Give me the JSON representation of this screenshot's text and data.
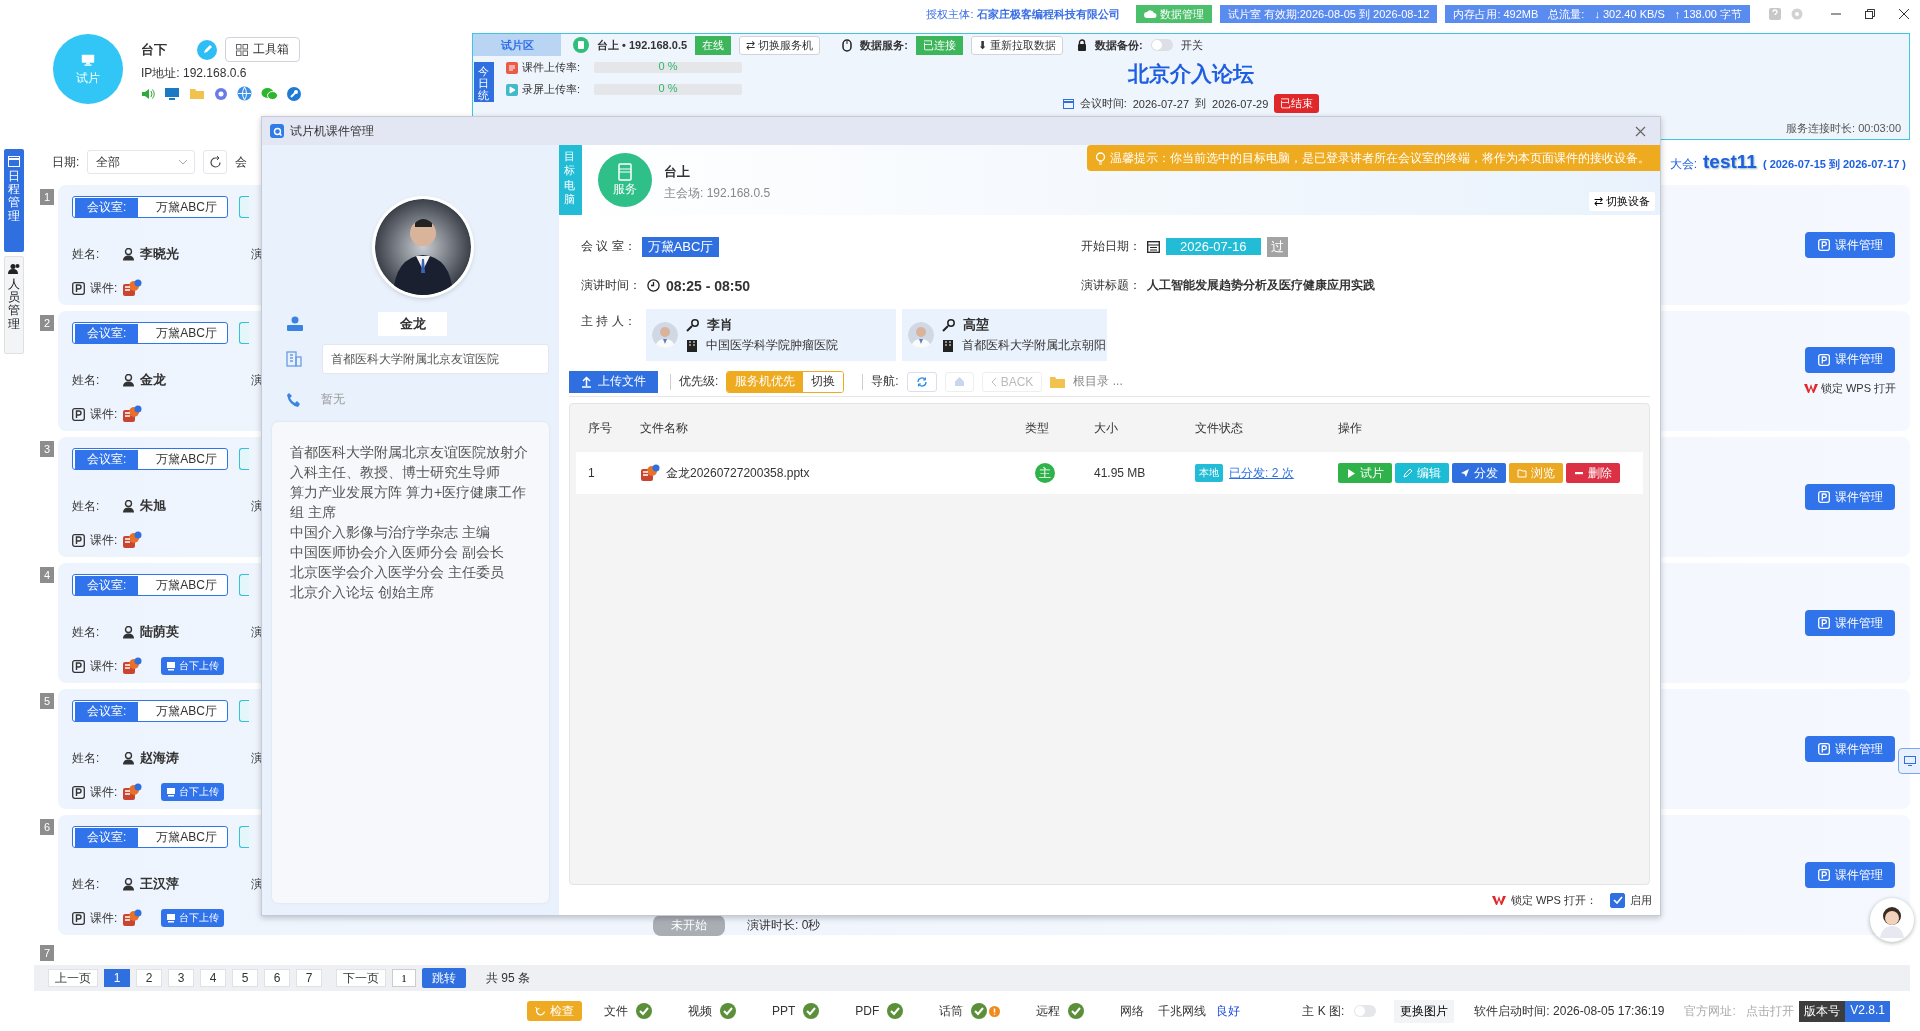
{
  "top_bar": {
    "license_label": "授权主体:",
    "license_holder": "石家庄极客编程科技有限公司",
    "data_button": "数据管理",
    "validity": "试片室 有效期:2026-08-05 到 2026-08-12",
    "memory_label": "内存占用:",
    "memory": "492MB",
    "traffic_label": "总流量:",
    "download": "↓ 302.40 KB/S",
    "upload": "↑ 138.00 字节"
  },
  "station": {
    "avatar_label": "试片",
    "name": "台下",
    "toolbox": "工具箱",
    "ip": "IP地址: 192.168.0.6"
  },
  "trial_panel": {
    "tab": "试片区",
    "host": "台上 • 192.168.0.5",
    "online": "在线",
    "switch_server": "⇄ 切换服务机",
    "data_service_label": "数据服务:",
    "data_service_status": "已连接",
    "refetch": "⬇ 重新拉取数据",
    "backup_label": "数据备份:",
    "backup_on": false,
    "backup_toggle_label": "开关",
    "side_tab": "今日统",
    "rates": [
      {
        "label": "课件上传率:",
        "level": 0,
        "reading": "0 %"
      },
      {
        "label": "录屏上传率:",
        "level": 0,
        "reading": "0 %"
      }
    ],
    "title": "北京介入论坛",
    "meeting_time_label": "会议时间:",
    "start": "2026-07-27",
    "to": "到",
    "end": "2026-07-29",
    "status": "已结束",
    "uptime": "服务连接时长: 00:03:00"
  },
  "sidebar": {
    "items": [
      {
        "label": "日程管理",
        "selected": true
      },
      {
        "label": "人员管理",
        "selected": false
      }
    ]
  },
  "filter": {
    "date_label": "日期:",
    "date_value": "全部",
    "cut_label": "会"
  },
  "congress": {
    "label": "大会:",
    "name": "test11",
    "range": "( 2026-07-15 到 2026-07-17 )"
  },
  "sessions": [
    {
      "index": "1",
      "room_label": "会议室:",
      "room": "万黛ABC厅",
      "name_label": "姓名:",
      "name": "李晓光",
      "cut": "演",
      "course_label": "课件:",
      "manage": "课件管理"
    },
    {
      "index": "2",
      "room_label": "会议室:",
      "room": "万黛ABC厅",
      "name_label": "姓名:",
      "name": "金龙",
      "cut": "演",
      "course_label": "课件:",
      "manage": "课件管理",
      "wps": "锁定 WPS 打开"
    },
    {
      "index": "3",
      "room_label": "会议室:",
      "room": "万黛ABC厅",
      "name_label": "姓名:",
      "name": "朱旭",
      "cut": "演",
      "course_label": "课件:",
      "manage": "课件管理"
    },
    {
      "index": "4",
      "room_label": "会议室:",
      "room": "万黛ABC厅",
      "name_label": "姓名:",
      "name": "陆荫英",
      "cut": "演",
      "course_label": "课件:",
      "upload_tag": "台下上传",
      "manage": "课件管理"
    },
    {
      "index": "5",
      "room_label": "会议室:",
      "room": "万黛ABC厅",
      "name_label": "姓名:",
      "name": "赵海涛",
      "cut": "演",
      "course_label": "课件:",
      "upload_tag": "台下上传",
      "manage": "课件管理"
    },
    {
      "index": "6",
      "room_label": "会议室:",
      "room": "万黛ABC厅",
      "name_label": "姓名:",
      "name": "王汉萍",
      "cut": "演",
      "course_label": "课件:",
      "upload_tag": "台下上传",
      "status": "未开始",
      "duration": "演讲时长: 0秒",
      "manage": "课件管理"
    },
    {
      "index": "7"
    }
  ],
  "pagination": {
    "prev": "上一页",
    "pages": [
      {
        "label": "1",
        "selected": true
      },
      {
        "label": "2",
        "selected": false
      },
      {
        "label": "3",
        "selected": false
      },
      {
        "label": "4",
        "selected": false
      },
      {
        "label": "5",
        "selected": false
      },
      {
        "label": "6",
        "selected": false
      },
      {
        "label": "7",
        "selected": false
      }
    ],
    "next": "下一页",
    "page_input": "1",
    "jump": "跳转",
    "total": "共 95 条"
  },
  "dialog": {
    "title": "试片机课件管理",
    "speaker": {
      "name": "金龙",
      "hospital": "首都医科大学附属北京友谊医院",
      "phone": "暂无",
      "bio": [
        "首都医科大学附属北京友谊医院放射介入科主任、教授、博士研究生导师",
        "算力产业发展方阵 算力+医疗健康工作组 主席",
        "中国介入影像与治疗学杂志 主编",
        "中国医师协会介入医师分会 副会长",
        "北京医学会介入医学分会 主任委员",
        "北京介入论坛 创始主席"
      ]
    },
    "target": {
      "tab": "目标电脑",
      "badge": "服务",
      "name": "台上",
      "address": "主会场: 192.168.0.5",
      "tip": "温馨提示：你当前选中的目标电脑，是已登录讲者所在会议室的终端，将作为本页面课件的接收设备。",
      "switch": "⇄ 切换设备"
    },
    "info": {
      "room_label": "会 议 室：",
      "room": "万黛ABC厅",
      "date_label": "开始日期：",
      "date": "2026-07-16",
      "past": "过",
      "time_label": "演讲时间：",
      "time": "08:25 - 08:50",
      "topic_label": "演讲标题：",
      "topic": "人工智能发展趋势分析及医疗健康应用实践",
      "hosts_label": "主 持 人："
    },
    "hosts": [
      {
        "name": "李肖",
        "hospital": "中国医学科学院肿瘤医院"
      },
      {
        "name": "高堃",
        "hospital": "首都医科大学附属北京朝阳"
      }
    ],
    "toolbar": {
      "upload": "上传文件",
      "priority_label": "优先级:",
      "priority": [
        {
          "label": "服务机优先",
          "selected": true
        },
        {
          "label": "切换",
          "selected": false
        }
      ],
      "nav_label": "导航:",
      "home_disabled": true,
      "back": "BACK",
      "back_disabled": true,
      "path": "根目录 ..."
    },
    "table": {
      "columns": [
        "序号",
        "文件名称",
        "类型",
        "大小",
        "文件状态",
        "操作"
      ],
      "rows": [
        {
          "index": "1",
          "name": "金龙20260727200358.pptx",
          "type": "主",
          "size": "41.95 MB",
          "location": "本地",
          "distributed": "已分发: 2 次",
          "actions": [
            {
              "label": "试片",
              "kind": "preview"
            },
            {
              "label": "编辑",
              "kind": "edit"
            },
            {
              "label": "分发",
              "kind": "send"
            },
            {
              "label": "浏览",
              "kind": "browse"
            },
            {
              "label": "删除",
              "kind": "delete"
            }
          ]
        }
      ]
    },
    "footer": {
      "wps_label": "锁定 WPS 打开：",
      "enabled": true,
      "enabled_label": "启用"
    }
  },
  "status_bar": {
    "check": "检查",
    "items": [
      {
        "label": "文件",
        "ok": true,
        "warning": false
      },
      {
        "label": "视频",
        "ok": true,
        "warning": false
      },
      {
        "label": "PPT",
        "ok": true,
        "warning": false
      },
      {
        "label": "PDF",
        "ok": true,
        "warning": false
      },
      {
        "label": "话筒",
        "ok": true,
        "warning": true
      },
      {
        "label": "远程",
        "ok": true,
        "warning": false
      }
    ],
    "network_label": "网络",
    "network_type": "千兆网线",
    "network_status": "良好",
    "kmap_label": "主 K 图:",
    "kmap_on": false,
    "change_image": "更换图片",
    "start_time": "软件启动时间: 2026-08-05 17:36:19",
    "site_label": "官方网址:",
    "site_link": "点击打开",
    "version_label": "版本号",
    "version": "V2.8.1"
  }
}
